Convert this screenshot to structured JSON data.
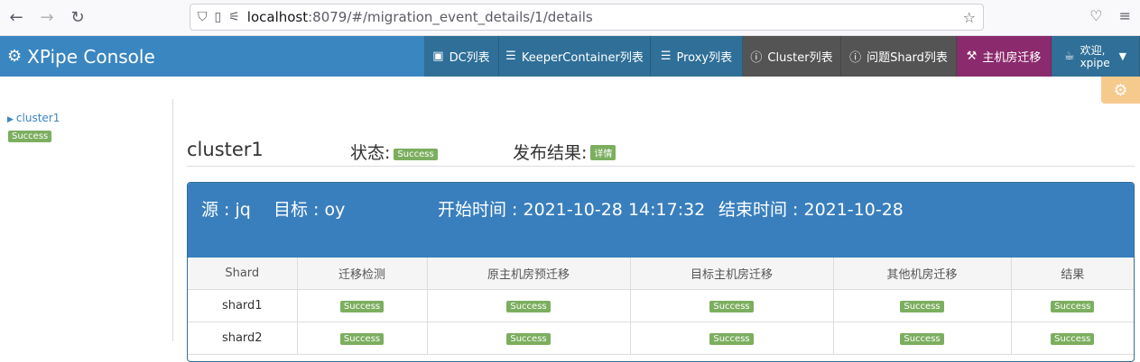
{
  "browser": {
    "url_host": "localhost",
    "url_rest": ":8079/#/migration_event_details/1/details"
  },
  "navbar": {
    "brand": "XPipe Console",
    "items": [
      {
        "label": "DC列表",
        "icon": "window-icon"
      },
      {
        "label": "KeeperContainer列表",
        "icon": "list-icon"
      },
      {
        "label": "Proxy列表",
        "icon": "list-icon"
      },
      {
        "label": "Cluster列表",
        "icon": "info-icon"
      },
      {
        "label": "问题Shard列表",
        "icon": "info-icon"
      },
      {
        "label": "主机房迁移",
        "icon": "gavel-icon"
      }
    ],
    "user_greeting": "欢迎,",
    "user_name": "xpipe"
  },
  "sidebar": {
    "cluster": "cluster1",
    "status": "Success"
  },
  "header": {
    "cluster": "cluster1",
    "status_label": "状态:",
    "status_value": "Success",
    "result_label": "发布结果:",
    "result_value": "详情"
  },
  "panel": {
    "source": "源 : jq",
    "target": "目标 : oy",
    "start": "开始时间 : 2021-10-28 14:17:32",
    "end": "结束时间 : 2021-10-28"
  },
  "table": {
    "headers": [
      "Shard",
      "迁移检测",
      "原主机房预迁移",
      "目标主机房迁移",
      "其他机房迁移",
      "结果"
    ],
    "rows": [
      {
        "shard": "shard1",
        "cells": [
          "Success",
          "Success",
          "Success",
          "Success",
          "Success"
        ]
      },
      {
        "shard": "shard2",
        "cells": [
          "Success",
          "Success",
          "Success",
          "Success",
          "Success"
        ]
      }
    ]
  }
}
